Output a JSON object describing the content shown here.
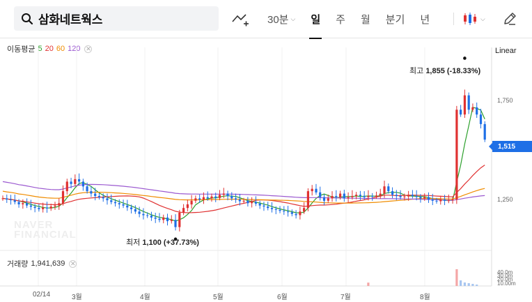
{
  "header": {
    "stock_name": "삼화네트웍스",
    "search_icon": "search-icon",
    "compare_icon": "compare-chart-icon",
    "periods": [
      {
        "label": "30분",
        "has_dropdown": true
      },
      {
        "label": "일",
        "active": true
      },
      {
        "label": "주"
      },
      {
        "label": "월"
      },
      {
        "label": "분기"
      },
      {
        "label": "년"
      }
    ],
    "chart_type_icon": "candlestick-icon",
    "drawing_icon": "pencil-icon"
  },
  "legend": {
    "ma_title": "이동평균",
    "ma_items": [
      {
        "label": "5",
        "color": "#2ca02c"
      },
      {
        "label": "20",
        "color": "#e03131"
      },
      {
        "label": "60",
        "color": "#f08c00"
      },
      {
        "label": "120",
        "color": "#9b59d0"
      }
    ],
    "volume_label": "거래량",
    "volume_value": "1,941,639",
    "scale_label": "Linear"
  },
  "annotations": {
    "high_label": "최고",
    "high_value": "1,855 (-18.33%)",
    "low_label": "최저",
    "low_value": "1,100 (+37.73%)"
  },
  "current_price": "1,515",
  "watermark": [
    "NAVER",
    "FINANCIAL"
  ],
  "colors": {
    "up": "#e03131",
    "down": "#1e6fe6",
    "accent": "#1e6fe6"
  },
  "chart_data": {
    "type": "candlestick",
    "y_ticks": [
      "1,750",
      "1,500",
      "1,250"
    ],
    "x_ticks": [
      "02/14",
      "3월",
      "4월",
      "5월",
      "6월",
      "7월",
      "8월"
    ],
    "volume_ticks": [
      "40.0m",
      "30.0m",
      "20.0m",
      "10.00m"
    ],
    "ylim": [
      1050,
      1900
    ],
    "moving_averages": [
      5,
      20,
      60,
      120
    ],
    "close_prices": [
      1270,
      1265,
      1262,
      1255,
      1245,
      1250,
      1240,
      1235,
      1230,
      1225,
      1232,
      1228,
      1236,
      1240,
      1250,
      1300,
      1340,
      1330,
      1350,
      1340,
      1320,
      1300,
      1290,
      1280,
      1275,
      1270,
      1262,
      1255,
      1250,
      1245,
      1240,
      1232,
      1225,
      1215,
      1205,
      1200,
      1198,
      1190,
      1185,
      1180,
      1190,
      1175,
      1180,
      1150,
      1210,
      1230,
      1245,
      1260,
      1270,
      1265,
      1275,
      1270,
      1278,
      1272,
      1285,
      1290,
      1280,
      1270,
      1265,
      1258,
      1260,
      1250,
      1255,
      1248,
      1240,
      1236,
      1230,
      1225,
      1222,
      1218,
      1215,
      1212,
      1205,
      1200,
      1215,
      1230,
      1300,
      1310,
      1295,
      1275,
      1260,
      1270,
      1280,
      1275,
      1290,
      1270,
      1275,
      1280,
      1285,
      1280,
      1275,
      1280,
      1278,
      1282,
      1290,
      1320,
      1300,
      1285,
      1280,
      1275,
      1278,
      1285,
      1280,
      1276,
      1270,
      1275,
      1265,
      1260,
      1258,
      1265,
      1260,
      1262,
      1265,
      1640,
      1620,
      1700,
      1640,
      1650,
      1620,
      1580,
      1515
    ],
    "volume_spikes": [
      {
        "x": "7월 초",
        "value": 8.0
      },
      {
        "x": "8월 말",
        "value": 40.0
      }
    ]
  }
}
